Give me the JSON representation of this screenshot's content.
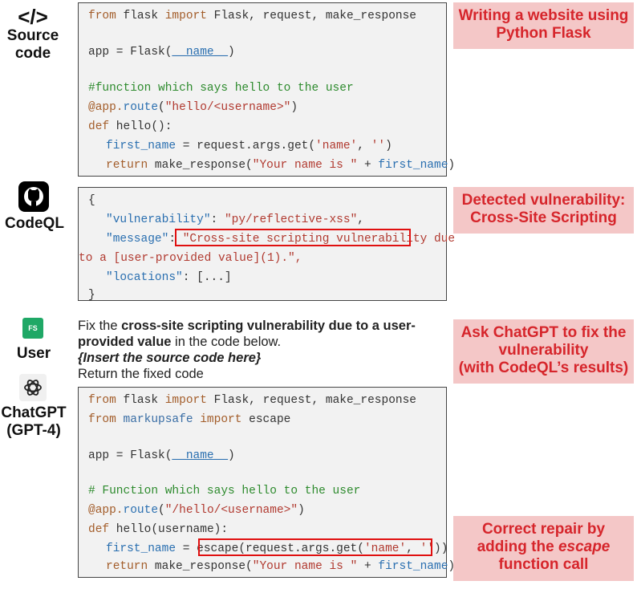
{
  "labels": {
    "source_icon": "</>",
    "source": "Source\ncode",
    "codeql": "CodeQL",
    "user_avatar": "FS",
    "user": "User",
    "chatgpt": "ChatGPT\n(GPT-4)"
  },
  "source_code": {
    "l1a": "from",
    "l1b": " flask ",
    "l1c": "import",
    "l1d": " Flask, request, make_response",
    "l2a": "app = Flask(",
    "l2b": "__name__",
    "l2c": ")",
    "l3": "#function which says hello to the user",
    "l4a": "@app.",
    "l4b": "route",
    "l4c": "(",
    "l4d": "\"hello/<username>\"",
    "l4e": ")",
    "l5a": "def",
    "l5b": " hello",
    "l5c": "():",
    "l6a": "first_name",
    "l6b": " = request.args.get(",
    "l6c": "'name'",
    "l6d": ", ",
    "l6e": "''",
    "l6f": ")",
    "l7a": "return",
    "l7b": " make_response(",
    "l7c": "\"Your name is \"",
    "l7d": " + ",
    "l7e": "first_name",
    "l7f": ")"
  },
  "codeql_output": {
    "l1": "{",
    "l2a": "\"vulnerability\"",
    "l2b": ": ",
    "l2c": "\"py/reflective-xss\"",
    "l2d": ",",
    "l3a": "\"message\"",
    "l3b": ": ",
    "l3c": "\"Cross-site scripting vulnerability due",
    "l4": "to a [user-provided value](1).\",",
    "l5a": "\"locations\"",
    "l5b": ": [...]",
    "l6": "}"
  },
  "prompt": {
    "p1": "Fix the ",
    "p2": "cross-site scripting vulnerability due to a user-provided value",
    "p3": " in the code below.",
    "p4": "{Insert the source code here}",
    "p5": "Return the fixed code"
  },
  "fixed_code": {
    "l1a": "from",
    "l1b": " flask ",
    "l1c": "import",
    "l1d": " Flask, request, make_response",
    "l2a": "from",
    "l2b": " markupsafe ",
    "l2c": "import",
    "l2d": " escape",
    "l3a": "app = Flask(",
    "l3b": "__name__",
    "l3c": ")",
    "l4": "# Function which says hello to the user",
    "l5a": "@app.",
    "l5b": "route",
    "l5c": "(",
    "l5d": "\"/hello/<username>\"",
    "l5e": ")",
    "l6a": "def",
    "l6b": " hello",
    "l6c": "(username):",
    "l7a": "first_name",
    "l7b": " = escape(request.args.get(",
    "l7c": "'name'",
    "l7d": ", ",
    "l7e": "''",
    "l7f": "))",
    "l8a": "return",
    "l8b": " make_response(",
    "l8c": "\"Your name is \"",
    "l8d": " + ",
    "l8e": "first_name",
    "l8f": ")"
  },
  "notes": {
    "n1": "Writing a website using Python Flask",
    "n2": "Detected vulnerability: Cross-Site Scripting",
    "n3": "Ask ChatGPT to fix the vulnerability\n(with CodeQL’s results)",
    "n4a": "Correct repair by adding the ",
    "n4b": "escape",
    "n4c": " function call"
  },
  "colors": {
    "note_bg": "#f4c7c7",
    "note_text": "#d6252b",
    "highlight_box": "#e01010",
    "code_bg": "#f2f2f2"
  }
}
